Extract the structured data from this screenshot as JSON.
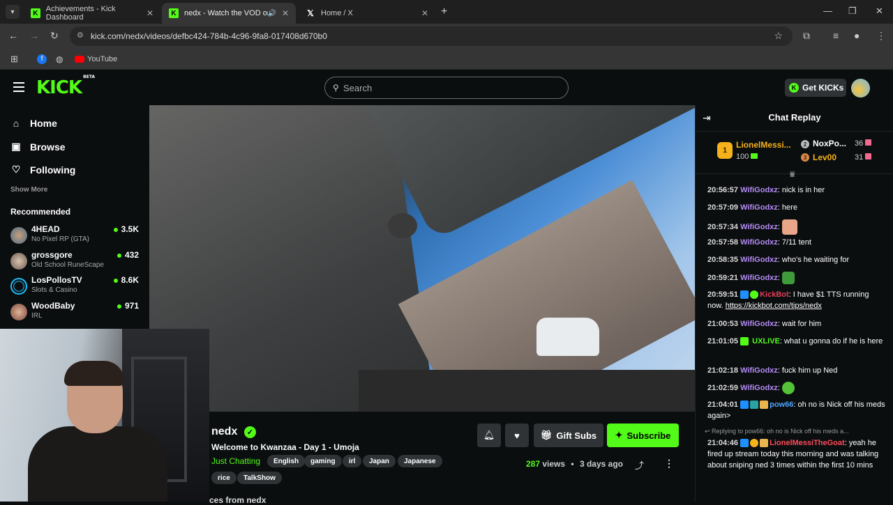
{
  "browser": {
    "tabs": [
      {
        "title": "Achievements - Kick Dashboard",
        "favicon": "K"
      },
      {
        "title": "nedx - Watch the VOD on Kick",
        "favicon": "K"
      },
      {
        "title": "Home / X",
        "favicon": "X"
      }
    ],
    "url": "kick.com/nedx/videos/defbc424-784b-4c96-9fa8-017408d670b0",
    "bookmarks": [
      "YouTube"
    ]
  },
  "header": {
    "logo": "KICK",
    "logo_badge": "BETA",
    "search_placeholder": "Search",
    "get_kicks": "Get KICKs"
  },
  "sidebar": {
    "nav": [
      {
        "label": "Home",
        "icon": "home-icon"
      },
      {
        "label": "Browse",
        "icon": "browse-icon"
      },
      {
        "label": "Following",
        "icon": "heart-icon"
      }
    ],
    "show_more": "Show More",
    "recommended_title": "Recommended",
    "recommended": [
      {
        "name": "4HEAD",
        "category": "No Pixel RP (GTA)",
        "viewers": "3.5K"
      },
      {
        "name": "grossgore",
        "category": "Old School RuneScape",
        "viewers": "432"
      },
      {
        "name": "LosPollosTV",
        "category": "Slots & Casino",
        "viewers": "8.6K"
      },
      {
        "name": "WoodBaby",
        "category": "IRL",
        "viewers": "971"
      }
    ]
  },
  "video_info": {
    "streamer": "nedx",
    "title": "Welcome to Kwanzaa - Day 1 - Umoja",
    "category": "Just Chatting",
    "tags": [
      "English",
      "gaming",
      "irl",
      "Japan",
      "Japanese",
      "rice",
      "TalkShow"
    ],
    "gift_subs": "Gift Subs",
    "subscribe": "Subscribe",
    "views_count": "287",
    "views_label": "views",
    "ago": "3 days ago",
    "more_from": "ces from nedx"
  },
  "chat": {
    "title": "Chat Replay",
    "leaderboard": {
      "first": {
        "rank": "1",
        "name": "LionelMessi...",
        "amount": "100"
      },
      "second": {
        "rank": "2",
        "name": "NoxPo...",
        "amount": "36"
      },
      "third": {
        "rank": "3",
        "name": "Lev00",
        "amount": "31"
      }
    },
    "messages": [
      {
        "ts": "20:56:57",
        "user": "WifiGodxz",
        "text": "nick is in her"
      },
      {
        "ts": "20:57:09",
        "user": "WifiGodxz",
        "text": "here"
      },
      {
        "ts": "20:57:34",
        "user": "WifiGodxz",
        "text": ""
      },
      {
        "ts": "20:57:58",
        "user": "WifiGodxz",
        "text": "7/11 tent"
      },
      {
        "ts": "20:58:35",
        "user": "WifiGodxz",
        "text": "who's he waiting for"
      },
      {
        "ts": "20:59:21",
        "user": "WifiGodxz",
        "text": ""
      },
      {
        "ts": "20:59:51",
        "user": "KickBot",
        "text": "I have $1 TTS running now.",
        "link": "https://kickbot.com/tips/nedx"
      },
      {
        "ts": "21:00:53",
        "user": "WifiGodxz",
        "text": "wait for him"
      },
      {
        "ts": "21:01:05",
        "user": "UXLIVE",
        "text": "what u gonna do if he is here"
      },
      {
        "ts": "21:02:18",
        "user": "WifiGodxz",
        "text": "fuck him up Ned"
      },
      {
        "ts": "21:02:59",
        "user": "WifiGodxz",
        "text": ""
      },
      {
        "ts": "21:04:01",
        "user": "pow66",
        "text": "oh no is Nick off his meds again>"
      },
      {
        "ts": "21:04:46",
        "user": "LionelMessiTheGoat",
        "text": "yeah he fired up stream today this morning and was talking about sniping ned 3 times within the first 10 mins"
      }
    ],
    "reply_note": "Replying to pow66: oh no is Nick off his meds a..."
  },
  "colors": {
    "accent": "#53fc18",
    "username_purple": "#b58cf7",
    "kickbot_red": "#e0405a",
    "pow66_blue": "#4da3ff",
    "lionel_red": "#ff4a5a"
  }
}
